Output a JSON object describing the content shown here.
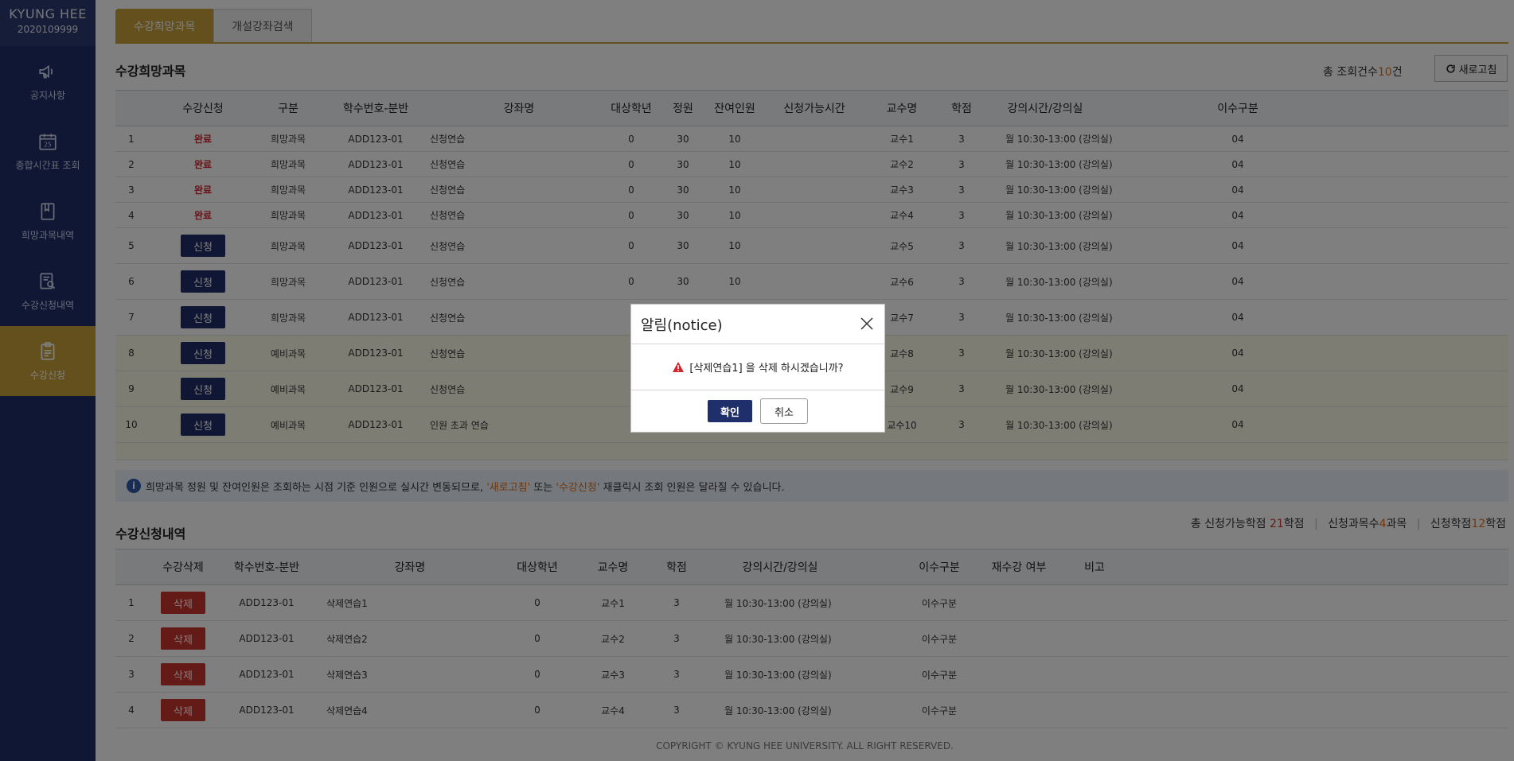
{
  "sidebar": {
    "brand": "KYUNG HEE",
    "student_id": "2020109999",
    "items": [
      {
        "label": "공지사항",
        "icon": "megaphone-icon"
      },
      {
        "label": "종합시간표 조회",
        "icon": "calendar-icon"
      },
      {
        "label": "희망과목내역",
        "icon": "book-icon"
      },
      {
        "label": "수강신청내역",
        "icon": "document-search-icon"
      },
      {
        "label": "수강신청",
        "icon": "clipboard-icon"
      }
    ],
    "active_index": 4
  },
  "tabs": [
    {
      "label": "수강희망과목",
      "active": true
    },
    {
      "label": "개설강좌검색",
      "active": false
    }
  ],
  "wish": {
    "title": "수강희망과목",
    "count_prefix": "총 조회건수",
    "count_value": "10",
    "count_suffix": "건",
    "refresh_label": "새로고침",
    "headers": [
      "수강신청",
      "구분",
      "학수번호-분반",
      "강좌명",
      "대상학년",
      "정원",
      "잔여인원",
      "신청가능시간",
      "교수명",
      "학점",
      "강의시간/강의실",
      "이수구분"
    ],
    "rows": [
      {
        "no": "1",
        "status": "완료",
        "cat": "희망과목",
        "code": "ADD123-01",
        "name": "신청연습",
        "grade": "0",
        "cap": "30",
        "remain": "10",
        "time": "",
        "prof": "교수1",
        "credit": "3",
        "sched": "월 10:30-13:00 (강의실)",
        "type": "04"
      },
      {
        "no": "2",
        "status": "완료",
        "cat": "희망과목",
        "code": "ADD123-01",
        "name": "신청연습",
        "grade": "0",
        "cap": "30",
        "remain": "10",
        "time": "",
        "prof": "교수2",
        "credit": "3",
        "sched": "월 10:30-13:00 (강의실)",
        "type": "04"
      },
      {
        "no": "3",
        "status": "완료",
        "cat": "희망과목",
        "code": "ADD123-01",
        "name": "신청연습",
        "grade": "0",
        "cap": "30",
        "remain": "10",
        "time": "",
        "prof": "교수3",
        "credit": "3",
        "sched": "월 10:30-13:00 (강의실)",
        "type": "04"
      },
      {
        "no": "4",
        "status": "완료",
        "cat": "희망과목",
        "code": "ADD123-01",
        "name": "신청연습",
        "grade": "0",
        "cap": "30",
        "remain": "10",
        "time": "",
        "prof": "교수4",
        "credit": "3",
        "sched": "월 10:30-13:00 (강의실)",
        "type": "04"
      },
      {
        "no": "5",
        "status": "신청",
        "cat": "희망과목",
        "code": "ADD123-01",
        "name": "신청연습",
        "grade": "0",
        "cap": "30",
        "remain": "10",
        "time": "",
        "prof": "교수5",
        "credit": "3",
        "sched": "월 10:30-13:00 (강의실)",
        "type": "04"
      },
      {
        "no": "6",
        "status": "신청",
        "cat": "희망과목",
        "code": "ADD123-01",
        "name": "신청연습",
        "grade": "0",
        "cap": "30",
        "remain": "10",
        "time": "",
        "prof": "교수6",
        "credit": "3",
        "sched": "월 10:30-13:00 (강의실)",
        "type": "04"
      },
      {
        "no": "7",
        "status": "신청",
        "cat": "희망과목",
        "code": "ADD123-01",
        "name": "신청연습",
        "grade": "",
        "cap": "",
        "remain": "",
        "time": "",
        "prof": "교수7",
        "credit": "3",
        "sched": "월 10:30-13:00 (강의실)",
        "type": "04"
      },
      {
        "no": "8",
        "status": "신청",
        "cat": "예비과목",
        "code": "ADD123-01",
        "name": "신청연습",
        "grade": "",
        "cap": "",
        "remain": "",
        "time": "",
        "prof": "교수8",
        "credit": "3",
        "sched": "월 10:30-13:00 (강의실)",
        "type": "04"
      },
      {
        "no": "9",
        "status": "신청",
        "cat": "예비과목",
        "code": "ADD123-01",
        "name": "신청연습",
        "grade": "",
        "cap": "",
        "remain": "",
        "time": "",
        "prof": "교수9",
        "credit": "3",
        "sched": "월 10:30-13:00 (강의실)",
        "type": "04"
      },
      {
        "no": "10",
        "status": "신청",
        "cat": "예비과목",
        "code": "ADD123-01",
        "name": "인원 초과 연습",
        "grade": "",
        "cap": "",
        "remain": "",
        "time": "",
        "prof": "교수10",
        "credit": "3",
        "sched": "월 10:30-13:00 (강의실)",
        "type": "04"
      }
    ]
  },
  "info": {
    "text1": "희망과목 정원 및 잔여인원은 조회하는 시점 기준 인원으로 실시간 변동되므로,",
    "hl1": "'새로고침'",
    "text2": "또는",
    "hl2": "'수강신청'",
    "text3": "재클릭시 조회 인원은 달라질 수 있습니다."
  },
  "enrolled": {
    "title": "수강신청내역",
    "summary_prefix1": "총 신청가능학점",
    "summary_value1": "21",
    "summary_suffix1": "학점",
    "summary_prefix2": "신청과목수",
    "summary_value2": "4",
    "summary_suffix2": "과목",
    "summary_prefix3": "신청학점",
    "summary_value3": "12",
    "summary_suffix3": "학점",
    "headers": [
      "수강삭제",
      "학수번호-분반",
      "강좌명",
      "대상학년",
      "교수명",
      "학점",
      "강의시간/강의실",
      "이수구분",
      "재수강 여부",
      "비고"
    ],
    "delete_label": "삭제",
    "rows": [
      {
        "no": "1",
        "code": "ADD123-01",
        "name": "삭제연습1",
        "grade": "0",
        "prof": "교수1",
        "credit": "3",
        "sched": "월 10:30-13:00 (강의실)",
        "type": "이수구분"
      },
      {
        "no": "2",
        "code": "ADD123-01",
        "name": "삭제연습2",
        "grade": "0",
        "prof": "교수2",
        "credit": "3",
        "sched": "월 10:30-13:00 (강의실)",
        "type": "이수구분"
      },
      {
        "no": "3",
        "code": "ADD123-01",
        "name": "삭제연습3",
        "grade": "0",
        "prof": "교수3",
        "credit": "3",
        "sched": "월 10:30-13:00 (강의실)",
        "type": "이수구분"
      },
      {
        "no": "4",
        "code": "ADD123-01",
        "name": "삭제연습4",
        "grade": "0",
        "prof": "교수4",
        "credit": "3",
        "sched": "월 10:30-13:00 (강의실)",
        "type": "이수구분"
      }
    ]
  },
  "footer": "COPYRIGHT © KYUNG HEE UNIVERSITY. ALL RIGHT RESERVED.",
  "modal": {
    "title": "알림(notice)",
    "message": "[삭제연습1] 을 삭제 하시겠습니까?",
    "ok_label": "확인",
    "cancel_label": "취소"
  },
  "colors": {
    "navy": "#1f2f6b",
    "gold": "#c7a13a",
    "delete_red": "#c9362f",
    "done_red": "#d0252b",
    "highlight_orange": "#e0701c"
  }
}
